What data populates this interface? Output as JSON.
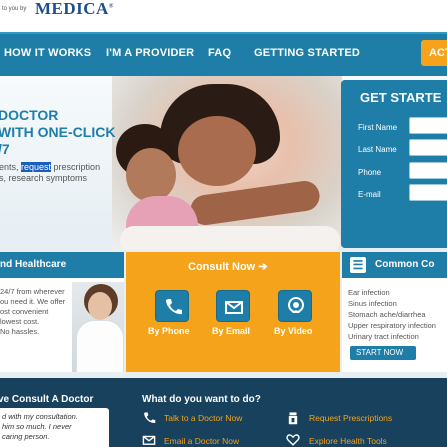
{
  "header": {
    "brought_by": "to you by",
    "brand": "MEDICA"
  },
  "nav": {
    "items": [
      "HOW IT WORKS",
      "I'M A PROVIDER",
      "FAQ",
      "GETTING STARTED"
    ],
    "cta": "ACT"
  },
  "hero": {
    "title": "DOCTOR\nWITH ONE-CLICK\n/7",
    "desc_before": "ents, ",
    "desc_highlight": "request",
    "desc_after": " prescription\ns, research symptoms"
  },
  "signup": {
    "title": "GET STARTE",
    "fields": [
      "First Name",
      "Last Name",
      "Phone",
      "E-mail"
    ]
  },
  "left_panel": {
    "title": "nd Healthcare",
    "text": "24/7 from wherever\nou need it. We offer\nost convenient\nlowest cost.\nNo hassles."
  },
  "consult": {
    "title": "Consult Now ➔",
    "options": [
      "By Phone",
      "By Email",
      "By Video"
    ]
  },
  "conditions": {
    "title": "Common Co",
    "items": [
      "Ear infection",
      "Sinus infection",
      "Stomach ache/diarrhea",
      "Upper respiratory infection",
      "Urinary tract infection"
    ],
    "button": "START NOW"
  },
  "footer": {
    "left_title": "ve Consult A Doctor",
    "quote": "d with my consultation.\nhim so much. I never\ncaring person.",
    "right_title": "What do you want to do?",
    "actions": [
      "Talk to a Doctor Now",
      "Request Prescriptions",
      "Email a Doctor Now",
      "Explore Health Tools"
    ]
  },
  "colors": {
    "primary": "#1f7ea7",
    "accent": "#f4a31a",
    "dark": "#17415d",
    "brand": "#1c4f8c"
  }
}
